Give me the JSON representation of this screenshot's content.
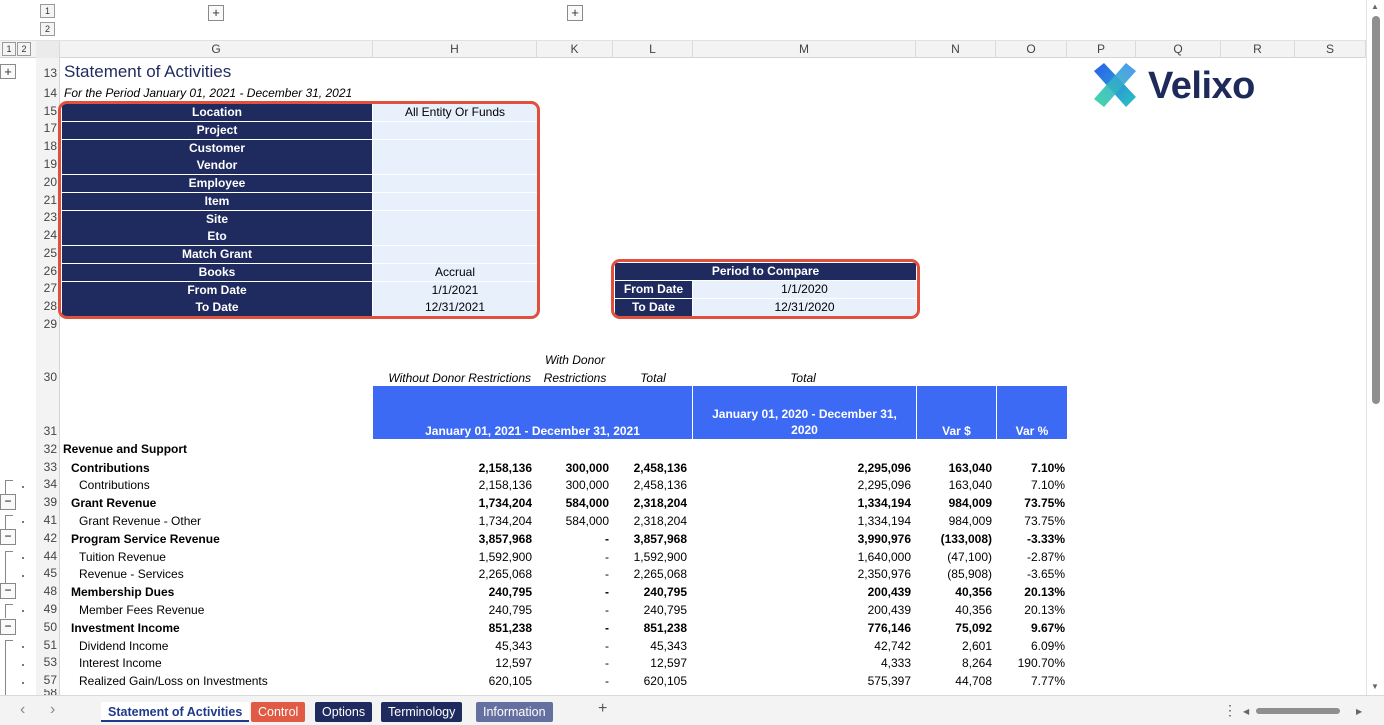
{
  "outline": {
    "levels_top": [
      "1",
      "2"
    ],
    "levels_side": [
      "1",
      "2"
    ],
    "expand": "+",
    "collapse": "−"
  },
  "columns": [
    "G",
    "H",
    "K",
    "L",
    "M",
    "N",
    "O",
    "P",
    "Q",
    "R",
    "S"
  ],
  "rows": [
    "13",
    "14",
    "15",
    "17",
    "18",
    "19",
    "20",
    "21",
    "23",
    "24",
    "25",
    "26",
    "27",
    "28",
    "29",
    "30",
    "31",
    "32",
    "33",
    "34",
    "39",
    "41",
    "42",
    "44",
    "45",
    "48",
    "49",
    "50",
    "51",
    "53",
    "57",
    "58"
  ],
  "report": {
    "title": "Statement of Activities",
    "subtitle": "For the Period January 01, 2021 - December 31, 2021"
  },
  "logo": {
    "text": "Velixo",
    "color": "#1e2a5a"
  },
  "filters": [
    {
      "label": "Location",
      "value": "All Entity Or Funds"
    },
    {
      "label": "Project",
      "value": ""
    },
    {
      "label": "Customer",
      "value": ""
    },
    {
      "label": "Vendor",
      "value": ""
    },
    {
      "label": "Employee",
      "value": ""
    },
    {
      "label": "Item",
      "value": ""
    },
    {
      "label": "Site",
      "value": ""
    },
    {
      "label": "Eto",
      "value": ""
    },
    {
      "label": "Match Grant",
      "value": ""
    },
    {
      "label": "Books",
      "value": "Accrual"
    },
    {
      "label": "From Date",
      "value": "1/1/2021"
    },
    {
      "label": "To Date",
      "value": "12/31/2021"
    }
  ],
  "compare": {
    "title": "Period to Compare",
    "rows": [
      {
        "label": "From Date",
        "value": "1/1/2020"
      },
      {
        "label": "To Date",
        "value": "12/31/2020"
      }
    ]
  },
  "headers": {
    "without_donor": "Without Donor Restrictions",
    "with_donor_1": "With Donor",
    "with_donor_2": "Restrictions",
    "total": "Total",
    "total_prior": "Total",
    "period_current": "January 01, 2021 - December 31, 2021",
    "period_prior_1": "January 01, 2020 - December 31,",
    "period_prior_2": "2020",
    "var_dollar": "Var $",
    "var_pct": "Var %"
  },
  "section_title": "Revenue and Support",
  "lines": [
    {
      "label": "Contributions",
      "bold": true,
      "indent": 1,
      "h": "2,158,136",
      "k": "300,000",
      "l": "2,458,136",
      "m": "2,295,096",
      "n": "163,040",
      "o": "7.10%"
    },
    {
      "label": "Contributions",
      "bold": false,
      "indent": 2,
      "h": "2,158,136",
      "k": "300,000",
      "l": "2,458,136",
      "m": "2,295,096",
      "n": "163,040",
      "o": "7.10%"
    },
    {
      "label": "Grant Revenue",
      "bold": true,
      "indent": 1,
      "h": "1,734,204",
      "k": "584,000",
      "l": "2,318,204",
      "m": "1,334,194",
      "n": "984,009",
      "o": "73.75%"
    },
    {
      "label": "Grant Revenue - Other",
      "bold": false,
      "indent": 2,
      "h": "1,734,204",
      "k": "584,000",
      "l": "2,318,204",
      "m": "1,334,194",
      "n": "984,009",
      "o": "73.75%"
    },
    {
      "label": "Program Service Revenue",
      "bold": true,
      "indent": 1,
      "h": "3,857,968",
      "k": "-",
      "l": "3,857,968",
      "m": "3,990,976",
      "n": "(133,008)",
      "o": "-3.33%"
    },
    {
      "label": "Tuition Revenue",
      "bold": false,
      "indent": 2,
      "h": "1,592,900",
      "k": "-",
      "l": "1,592,900",
      "m": "1,640,000",
      "n": "(47,100)",
      "o": "-2.87%"
    },
    {
      "label": "Revenue - Services",
      "bold": false,
      "indent": 2,
      "h": "2,265,068",
      "k": "-",
      "l": "2,265,068",
      "m": "2,350,976",
      "n": "(85,908)",
      "o": "-3.65%"
    },
    {
      "label": "Membership Dues",
      "bold": true,
      "indent": 1,
      "h": "240,795",
      "k": "-",
      "l": "240,795",
      "m": "200,439",
      "n": "40,356",
      "o": "20.13%"
    },
    {
      "label": "Member Fees Revenue",
      "bold": false,
      "indent": 2,
      "h": "240,795",
      "k": "-",
      "l": "240,795",
      "m": "200,439",
      "n": "40,356",
      "o": "20.13%"
    },
    {
      "label": "Investment Income",
      "bold": true,
      "indent": 1,
      "h": "851,238",
      "k": "-",
      "l": "851,238",
      "m": "776,146",
      "n": "75,092",
      "o": "9.67%"
    },
    {
      "label": "Dividend Income",
      "bold": false,
      "indent": 2,
      "h": "45,343",
      "k": "-",
      "l": "45,343",
      "m": "42,742",
      "n": "2,601",
      "o": "6.09%"
    },
    {
      "label": "Interest Income",
      "bold": false,
      "indent": 2,
      "h": "12,597",
      "k": "-",
      "l": "12,597",
      "m": "4,333",
      "n": "8,264",
      "o": "190.70%"
    },
    {
      "label": "Realized Gain/Loss on Investments",
      "bold": false,
      "indent": 2,
      "h": "620,105",
      "k": "-",
      "l": "620,105",
      "m": "575,397",
      "n": "44,708",
      "o": "7.77%"
    }
  ],
  "sheet_tabs": [
    {
      "label": "Statement of Activities",
      "bg": "#ffffff",
      "fg": "#1f3a8a",
      "active": true
    },
    {
      "label": "Control",
      "bg": "#e05a44",
      "fg": "#ffffff",
      "active": false
    },
    {
      "label": "Options",
      "bg": "#1f2b5e",
      "fg": "#ffffff",
      "active": false
    },
    {
      "label": "Terminology",
      "bg": "#1f2b5e",
      "fg": "#ffffff",
      "active": false
    },
    {
      "label": "Information",
      "bg": "#6670a0",
      "fg": "#ffffff",
      "active": false
    }
  ],
  "nav": {
    "prev": "‹",
    "next": "›",
    "add_sheet": "+",
    "more": "⋮"
  }
}
